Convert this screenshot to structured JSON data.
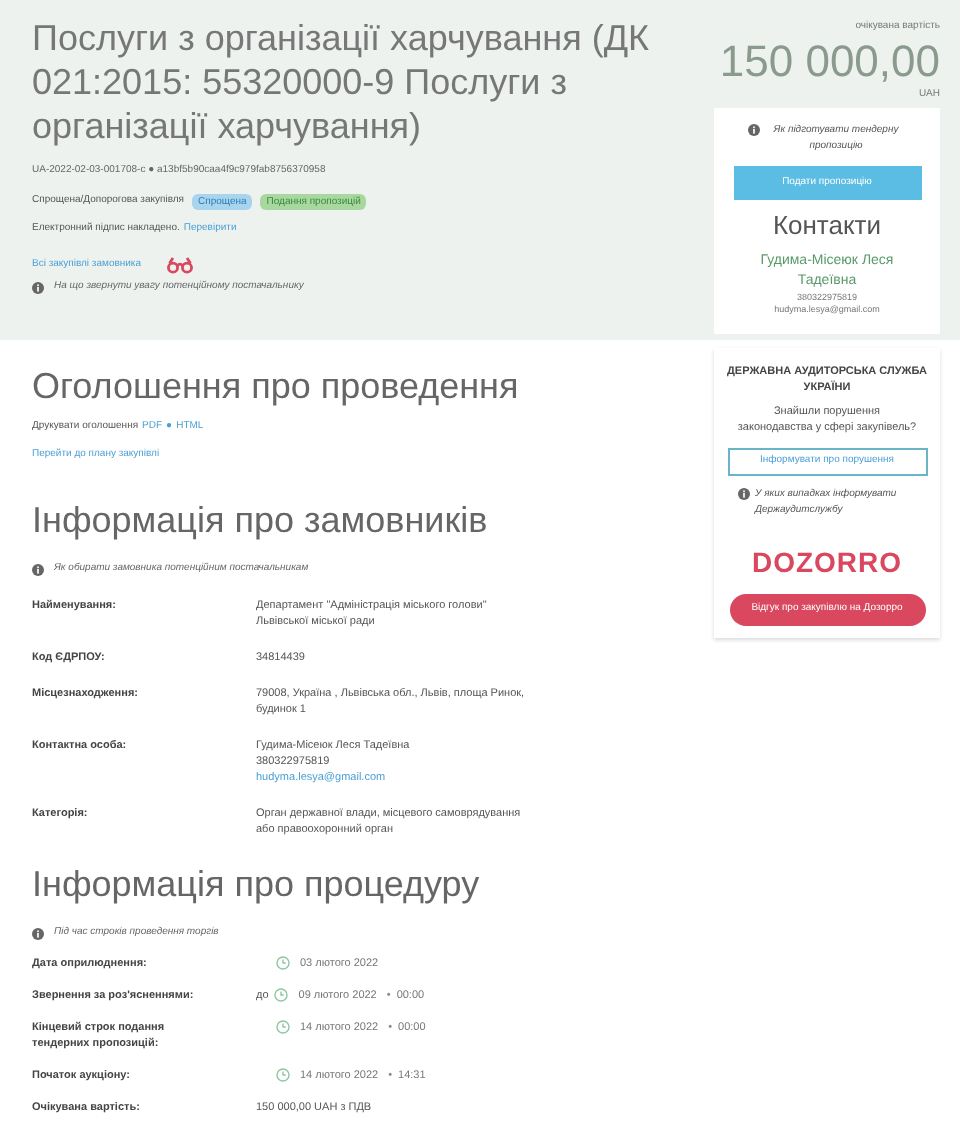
{
  "header": {
    "title": "Послуги з організації харчування (ДК 021:2015: 55320000-9 Послуги з організації харчування)",
    "tender_id": "UA-2022-02-03-001708-c ● a13bf5b90caa4f9c979fab8756370958",
    "procurement_type": "Спрощена/Допорогова закупівля",
    "badges": [
      {
        "label": "Спрощена",
        "kind": "type"
      },
      {
        "label": "Подання пропозицій",
        "kind": "status"
      }
    ],
    "signature": {
      "text": "Електронний підпис накладено.",
      "link": "Перевірити"
    },
    "customer_link": "Всі закупівлі замовника",
    "hint": "На що звернути увагу потенційному постачальнику"
  },
  "price": {
    "label": "очікувана вартість",
    "amount": "150 000,00",
    "currency": "UAH"
  },
  "sidebar": {
    "hint": "Як підготувати тендерну пропозицію",
    "submit_button": "Подати пропозицію",
    "contacts_title": "Контакти",
    "contact_name": "Гудима-Місеюк Леся Тадеївна",
    "contact_phone": "380322975819",
    "contact_email": "hudyma.lesya@gmail.com",
    "audit": {
      "title": "ДЕРЖАВНА АУДИТОРСЬКА СЛУЖБА УКРАЇНИ",
      "question": "Знайшли порушення законодавства у сфері закупівель?",
      "button": "Інформувати про порушення",
      "hint": "У яких випадках інформувати Держаудитслужбу"
    },
    "dozorro": {
      "logo": "DOZORRO",
      "button": "Відгук про закупівлю на Дозорро"
    }
  },
  "notice": {
    "title": "Оголошення про проведення",
    "print_label": "Друкувати оголошення",
    "print_links": [
      "PDF",
      "HTML"
    ],
    "print_separator": "●",
    "plan_link": "Перейти до плану закупівлі"
  },
  "customer": {
    "title": "Інформація про замовників",
    "hint": "Як обирати замовника потенційним постачальникам",
    "rows": [
      {
        "label": "Найменування:",
        "lines": [
          {
            "text": "Департамент \"Адміністрація міського голови\" Львівської міської ради",
            "kind": "text"
          }
        ]
      },
      {
        "label": "Код ЄДРПОУ:",
        "lines": [
          {
            "text": "34814439",
            "kind": "text"
          }
        ]
      },
      {
        "label": "Місцезнаходження:",
        "lines": [
          {
            "text": "79008, Україна , Львівська обл., Львів, площа Ринок, будинок 1",
            "kind": "text"
          }
        ]
      },
      {
        "label": "Контактна особа:",
        "lines": [
          {
            "text": "Гудима-Місеюк Леся Тадеївна",
            "kind": "text"
          },
          {
            "text": "380322975819",
            "kind": "text"
          },
          {
            "text": "hudyma.lesya@gmail.com",
            "kind": "link"
          }
        ]
      },
      {
        "label": "Категорія:",
        "lines": [
          {
            "text": "Орган державної влади, місцевого самоврядування або правоохоронний орган",
            "kind": "text"
          }
        ]
      }
    ]
  },
  "procedure": {
    "title": "Інформація про процедуру",
    "hint": "Під час строків проведення торгів",
    "rows": [
      {
        "label": "Дата оприлюднення:",
        "kind": "date",
        "date": "03 лютого 2022"
      },
      {
        "label": "Звернення за роз'ясненнями:",
        "kind": "date",
        "prefix": "до",
        "date": "09 лютого 2022",
        "separator": "•",
        "time": "00:00"
      },
      {
        "label": "Кінцевий строк подання тендерних пропозицій:",
        "kind": "date",
        "date": "14 лютого 2022",
        "separator": "•",
        "time": "00:00"
      },
      {
        "label": "Початок аукціону:",
        "kind": "date",
        "date": "14 лютого 2022",
        "separator": "•",
        "time": "14:31"
      },
      {
        "label": "Очікувана вартість:",
        "kind": "text",
        "value": "150 000,00 UAH з ПДВ"
      }
    ]
  }
}
